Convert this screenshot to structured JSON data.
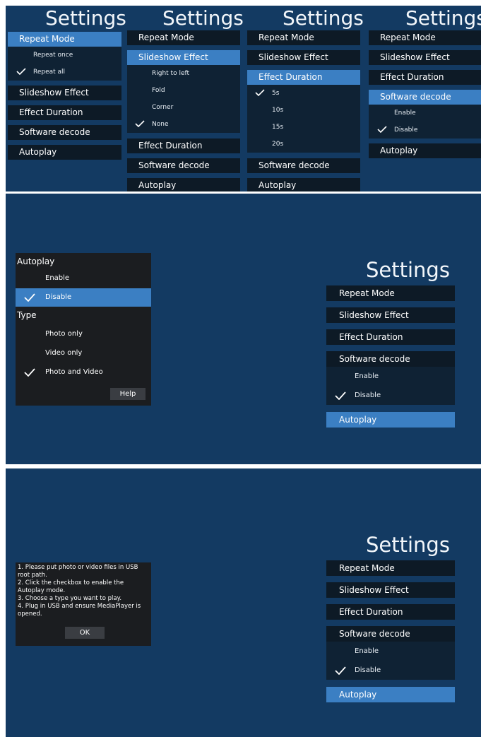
{
  "settings_title": "Settings",
  "menu": {
    "repeat_mode": "Repeat Mode",
    "slideshow_effect": "Slideshow Effect",
    "effect_duration": "Effect Duration",
    "software_decode": "Software decode",
    "autoplay": "Autoplay"
  },
  "repeat_options": [
    "Repeat once",
    "Repeat all"
  ],
  "slideshow_options": [
    "Right to left",
    "Fold",
    "Corner",
    "None"
  ],
  "duration_options": [
    "5s",
    "10s",
    "15s",
    "20s"
  ],
  "decode_options": [
    "Enable",
    "Disable"
  ],
  "autoplay_dialog": {
    "autoplay_label": "Autoplay",
    "autoplay_options": [
      "Enable",
      "Disable"
    ],
    "type_label": "Type",
    "type_options": [
      "Photo only",
      "Video only",
      "Photo and Video"
    ],
    "help_label": "Help"
  },
  "help_dialog": {
    "lines": [
      "1. Please put photo or video files in USB",
      "root path.",
      "2. Click the checkbox to enable the",
      "Autoplay mode.",
      "3. Choose a type you want to play.",
      "4. Plug in USB and ensure MediaPlayer is",
      "opened."
    ],
    "ok_label": "OK"
  },
  "colors": {
    "background": "#133a62",
    "item_bg": "#0d1a26",
    "selected": "#3b7fc3",
    "dialog_bg": "#1b1d20"
  }
}
